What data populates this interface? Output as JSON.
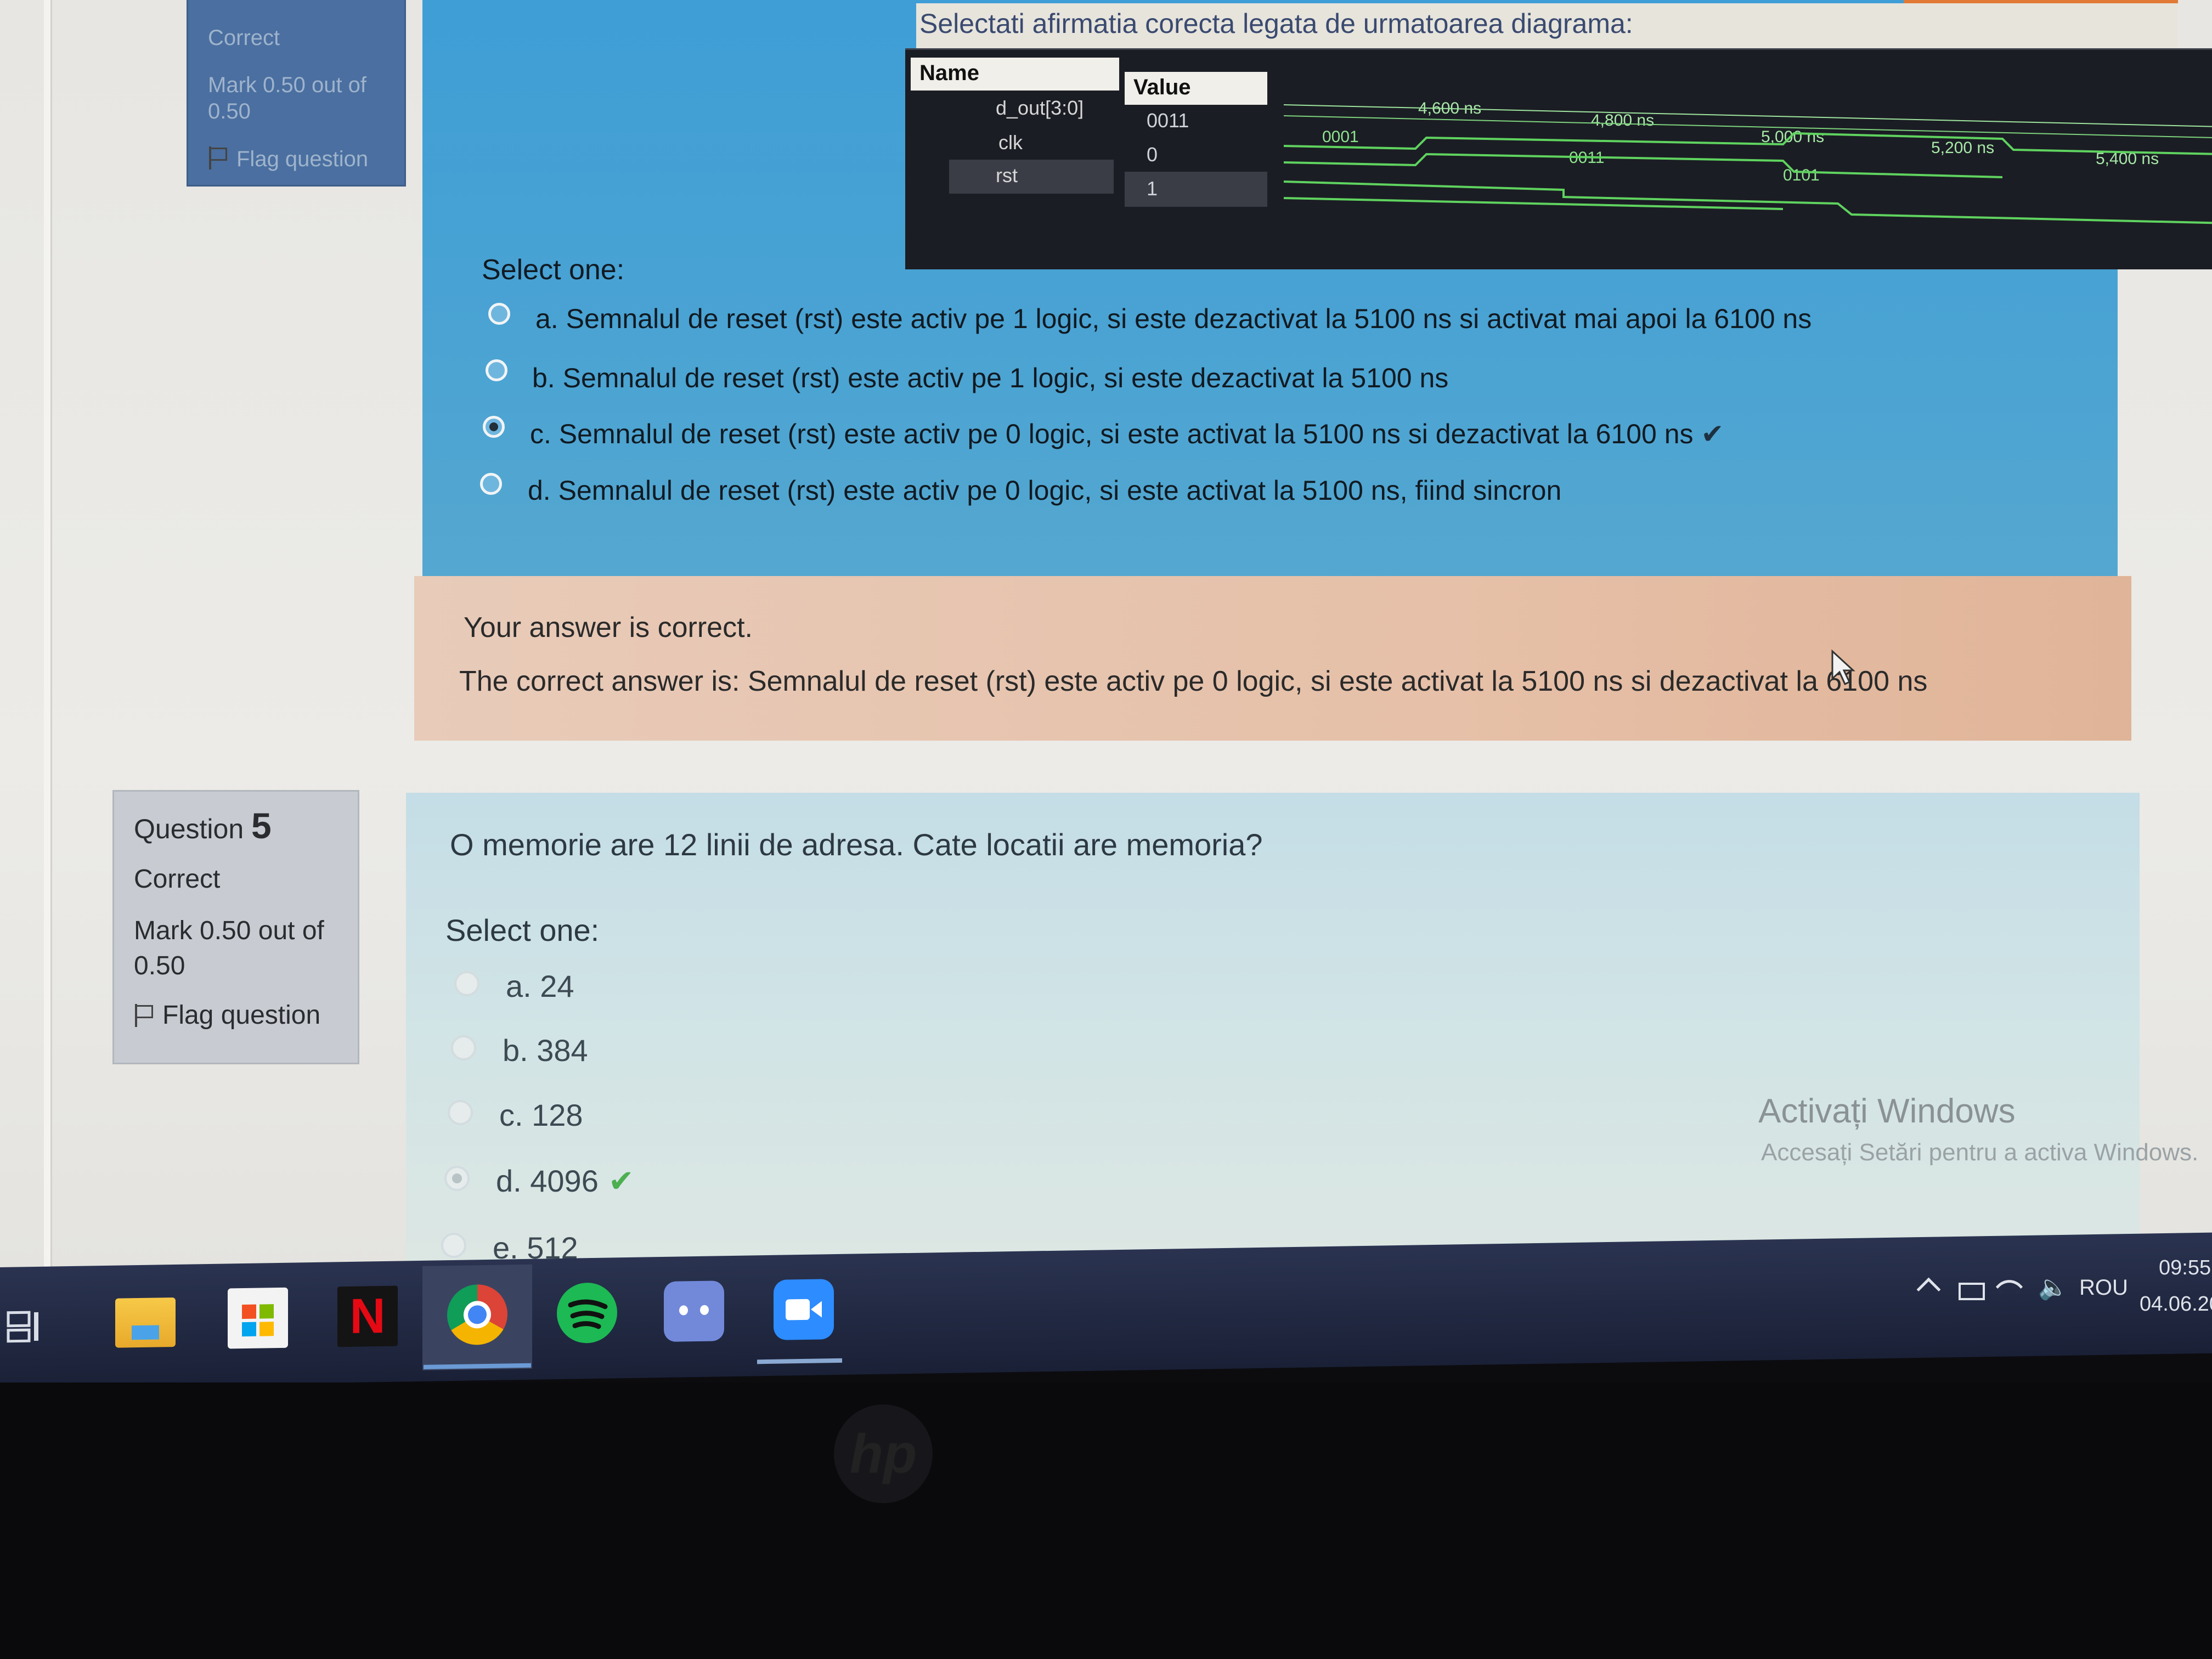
{
  "q4": {
    "info": {
      "status": "Correct",
      "mark_line1": "Mark 0.50 out of",
      "mark_line2": "0.50",
      "flag": "Flag question"
    },
    "title": "Selectati afirmatia corecta legata de urmatoarea diagrama:",
    "waveform": {
      "name_header": "Name",
      "value_header": "Value",
      "signals": [
        {
          "name": "d_out[3:0]",
          "value": "0011"
        },
        {
          "name": "clk",
          "value": "0"
        },
        {
          "name": "rst",
          "value": "1"
        }
      ],
      "times": [
        "4,600 ns",
        "4,800 ns",
        "5,000 ns",
        "5,200 ns",
        "5,400 ns"
      ],
      "bus_values": [
        "0001",
        "0011",
        "0101"
      ]
    },
    "select_label": "Select one:",
    "options": [
      {
        "label": "a. Semnalul de reset (rst) este activ pe 1 logic, si este dezactivat la 5100 ns si activat mai apoi la 6100 ns",
        "selected": false
      },
      {
        "label": "b. Semnalul de reset (rst) este activ pe 1 logic, si este dezactivat la 5100 ns",
        "selected": false
      },
      {
        "label": "c. Semnalul de reset (rst) este activ pe 0 logic, si este activat la 5100 ns si dezactivat la 6100 ns",
        "selected": true,
        "check": "✔"
      },
      {
        "label": "d. Semnalul de reset (rst) este activ pe 0 logic, si este activat la 5100 ns, fiind sincron",
        "selected": false
      }
    ],
    "feedback": {
      "result": "Your answer is correct.",
      "correct_answer": "The correct answer is: Semnalul de reset (rst) este activ pe 0 logic, si este activat la 5100 ns si dezactivat la 6100 ns"
    }
  },
  "q5": {
    "info": {
      "question_word": "Question",
      "number": "5",
      "status": "Correct",
      "mark_line1": "Mark 0.50 out of",
      "mark_line2": "0.50",
      "flag": "Flag question"
    },
    "text": "O memorie are 12 linii de adresa. Cate locatii are memoria?",
    "select_label": "Select one:",
    "options": [
      {
        "label": "a. 24",
        "selected": false
      },
      {
        "label": "b. 384",
        "selected": false
      },
      {
        "label": "c. 128",
        "selected": false
      },
      {
        "label": "d. 4096",
        "selected": true,
        "check": "✔"
      },
      {
        "label": "e. 512",
        "selected": false
      }
    ]
  },
  "watermark": {
    "line1": "Activați Windows",
    "line2": "Accesați Setări pentru a activa Windows."
  },
  "taskbar": {
    "icons": [
      "task-view-icon",
      "file-explorer-icon",
      "microsoft-store-icon",
      "netflix-icon",
      "chrome-icon",
      "spotify-icon",
      "discord-icon",
      "zoom-icon"
    ],
    "netflix_letter": "N",
    "tray": {
      "language": "ROU",
      "time": "09:55",
      "date": "04.06.20"
    }
  },
  "colors": {
    "q4_panel": "#4aa3d3",
    "feedback_bg": "#e6c0a8",
    "q5_panel": "#cfe3e6",
    "taskbar": "#1a2036",
    "correct_green": "#4caf50"
  }
}
